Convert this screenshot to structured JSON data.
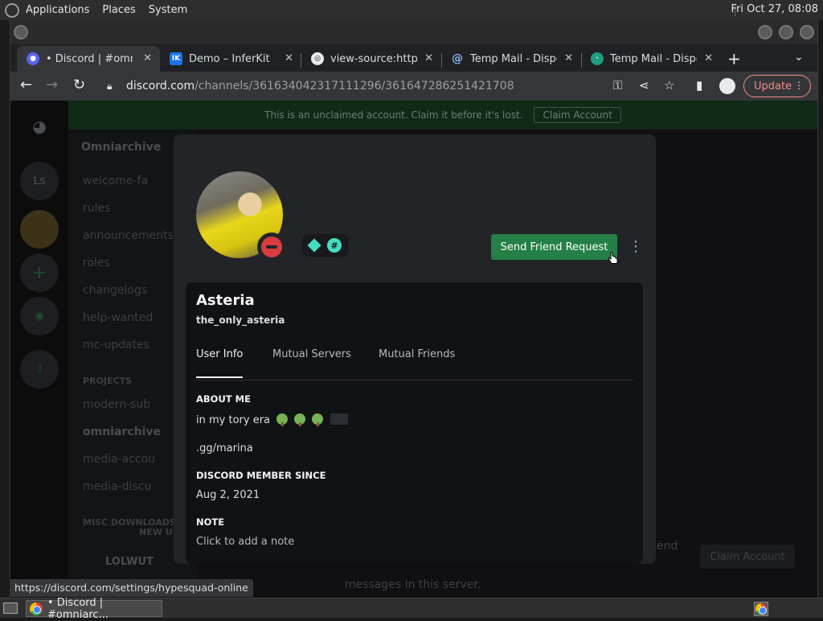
{
  "desktop": {
    "menu": [
      "Applications",
      "Places",
      "System"
    ],
    "clock": "Fri Oct 27, 08:08"
  },
  "browser": {
    "tabs": [
      {
        "label": "• Discord | #omniar",
        "icon": "discord-icon",
        "color": "#5865f2"
      },
      {
        "label": "Demo – InferKit",
        "icon": "inferkit-icon",
        "color": "#1a73e8",
        "fav_text": "IK"
      },
      {
        "label": "view-source:https:",
        "icon": "page-icon",
        "color": "#e8eaed"
      },
      {
        "label": "Temp Mail - Dispo",
        "icon": "at-icon",
        "color": "#8ab4f8"
      },
      {
        "label": "Temp Mail - Dispo",
        "icon": "tempmail-icon",
        "color": "#1e9e80"
      }
    ],
    "url_host": "discord.com",
    "url_path": "/channels/361634042317111296/361647286251421708",
    "update_label": "Update",
    "status_url": "https://discord.com/settings/hypesquad-online"
  },
  "discord_bg": {
    "banner": "This is an unclaimed account. Claim it before it's lost.",
    "banner_button": "Claim Account",
    "server_name": "Omniarchive",
    "guild_initials": "Ls",
    "channels": [
      "welcome-fa",
      "rules",
      "announcements",
      "roles",
      "changelogs",
      "help-wanted",
      "mc-updates"
    ],
    "category_projects": "PROJECTS",
    "project_channels": [
      "modern-sub",
      "omniarchive",
      "media-accou",
      "media-discu"
    ],
    "category_misc": "MISC DOWNLOADS",
    "new_unread": "NEW UN",
    "user_name": "LOLWUT",
    "bg_message": "messages in this server.",
    "bg_send": "end",
    "bg_claim": "Claim Account"
  },
  "profile": {
    "display_name": "Asteria",
    "username": "the_only_asteria",
    "friend_button": "Send Friend Request",
    "tabs": [
      "User Info",
      "Mutual Servers",
      "Mutual Friends"
    ],
    "about_title": "ABOUT ME",
    "about_text": "in my tory era",
    "about_link": ".gg/marina",
    "member_since_title": "DISCORD MEMBER SINCE",
    "member_since": "Aug 2, 2021",
    "note_title": "NOTE",
    "note_placeholder": "Click to add a note",
    "status": "do-not-disturb",
    "status_color": "#d83c3e",
    "button_color": "#248046"
  },
  "taskbar": {
    "window_label": "• Discord | #omniarc..."
  }
}
